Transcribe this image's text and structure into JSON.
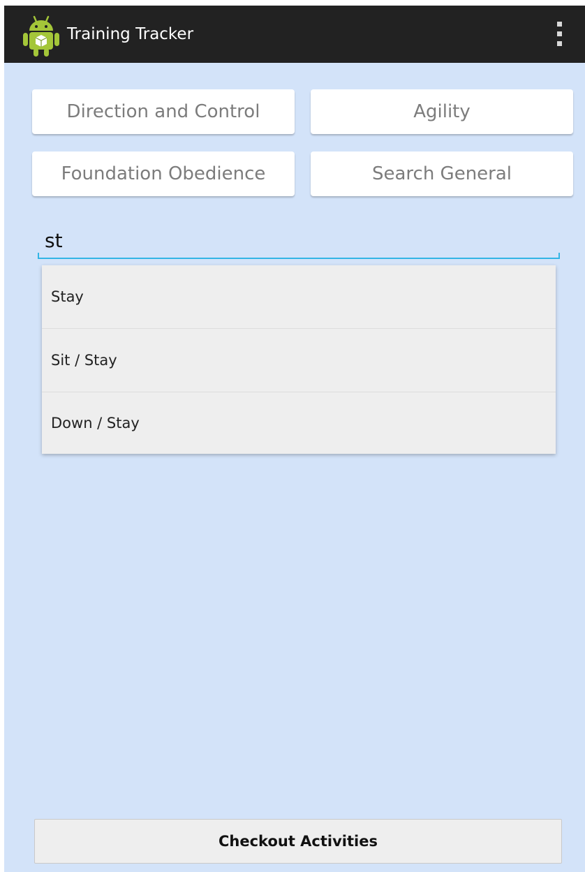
{
  "action_bar": {
    "title": "Training Tracker",
    "icon": "android-robot-icon",
    "overflow_icon": "overflow-menu-icon",
    "background": "#222222"
  },
  "categories": [
    {
      "label": "Direction and Control"
    },
    {
      "label": "Agility"
    },
    {
      "label": "Foundation Obedience"
    },
    {
      "label": "Search General"
    }
  ],
  "search": {
    "value": "st",
    "underline_color": "#33b5e5"
  },
  "suggestions": [
    {
      "label": "Stay"
    },
    {
      "label": "Sit / Stay"
    },
    {
      "label": "Down / Stay"
    }
  ],
  "checkout": {
    "label": "Checkout Activities"
  },
  "colors": {
    "screen_background": "#d3e3f9",
    "accent": "#33b5e5",
    "android_green": "#a4c639"
  }
}
